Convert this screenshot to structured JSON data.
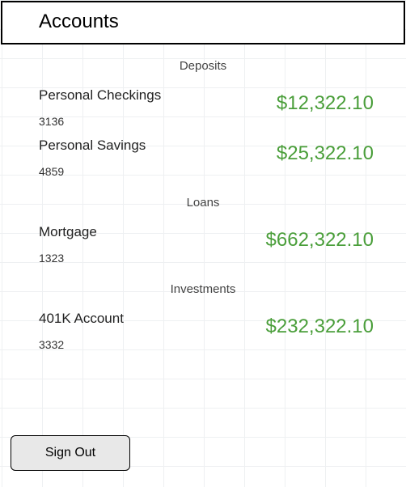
{
  "header": {
    "title": "Accounts"
  },
  "sections": {
    "deposits": {
      "label": "Deposits",
      "items": [
        {
          "name": "Personal Checkings",
          "number": "3136",
          "balance": "$12,322.10"
        },
        {
          "name": "Personal Savings",
          "number": "4859",
          "balance": "$25,322.10"
        }
      ]
    },
    "loans": {
      "label": "Loans",
      "items": [
        {
          "name": "Mortgage",
          "number": "1323",
          "balance": "$662,322.10"
        }
      ]
    },
    "investments": {
      "label": "Investments",
      "items": [
        {
          "name": "401K Account",
          "number": "3332",
          "balance": "$232,322.10"
        }
      ]
    }
  },
  "actions": {
    "sign_out": "Sign Out"
  }
}
